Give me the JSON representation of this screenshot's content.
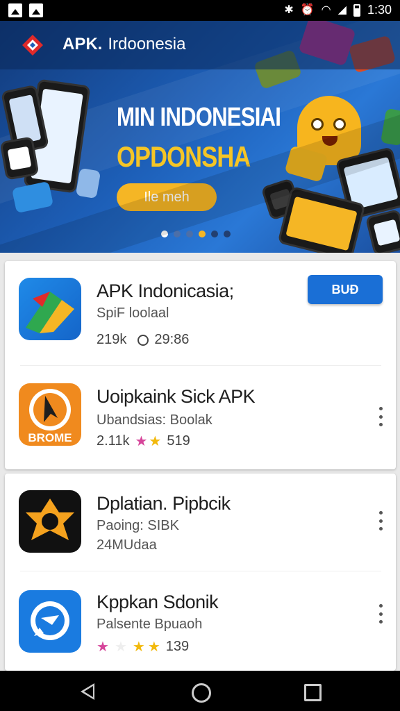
{
  "status_bar": {
    "time": "1:30"
  },
  "header": {
    "brand": "APK.",
    "title": "Irdoonesia"
  },
  "banner": {
    "headline": "MIN INDONESIAI",
    "subheadline": "OPDONSHA",
    "cta_label": "Ile meh",
    "dots": 6,
    "active_dot": 0
  },
  "apps": [
    {
      "name": "APK Indonicasia;",
      "subtitle": "SpiF loolaal",
      "downloads": "219k",
      "comments": "29:86",
      "action": "BUÐ"
    },
    {
      "name": "Uoipkaink Sick APK",
      "subtitle": "Ubandsias: Boolak",
      "downloads": "2.11k",
      "rating_text": "519",
      "icon_text": "BROME"
    },
    {
      "name": "Dplatian. Pipbcik",
      "subtitle": "Paoing: SIBK",
      "meta": "24MUdaa"
    },
    {
      "name": "Kppkan Sdonik",
      "subtitle": "Palsente Bpuaoh",
      "rating_text": "139"
    }
  ],
  "colors": {
    "accent": "#1a6fd6",
    "gold": "#f5b625",
    "banner": "#1d5fb8"
  }
}
